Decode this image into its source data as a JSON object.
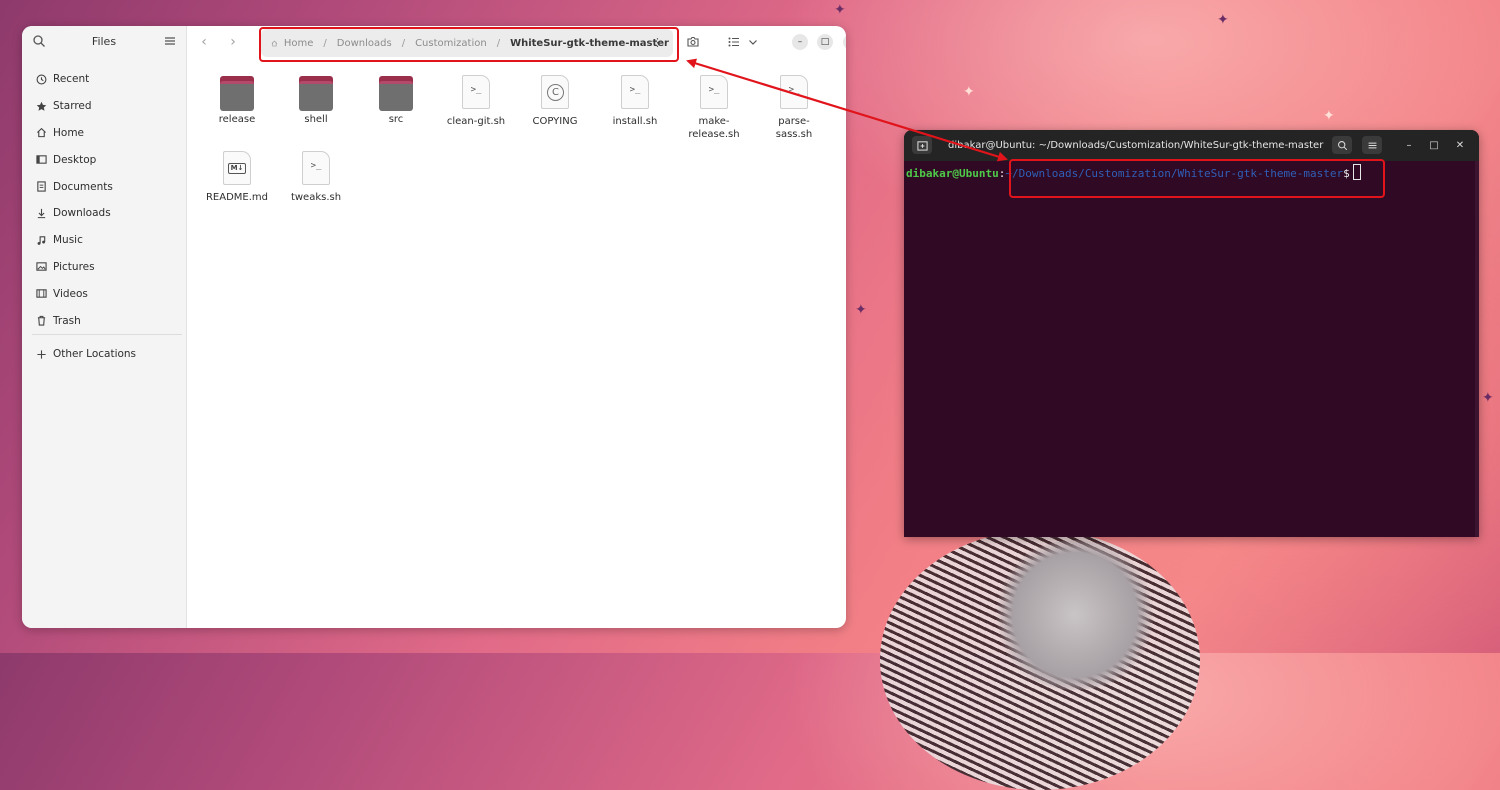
{
  "files_window": {
    "title": "Files",
    "sidebar": {
      "items": [
        {
          "label": "Recent",
          "icon": "clock-icon"
        },
        {
          "label": "Starred",
          "icon": "star-icon"
        },
        {
          "label": "Home",
          "icon": "home-icon"
        },
        {
          "label": "Desktop",
          "icon": "desktop-icon"
        },
        {
          "label": "Documents",
          "icon": "document-icon"
        },
        {
          "label": "Downloads",
          "icon": "download-icon"
        },
        {
          "label": "Music",
          "icon": "music-icon"
        },
        {
          "label": "Pictures",
          "icon": "picture-icon"
        },
        {
          "label": "Videos",
          "icon": "video-icon"
        },
        {
          "label": "Trash",
          "icon": "trash-icon"
        }
      ],
      "other": {
        "label": "Other Locations",
        "icon": "plus-icon"
      }
    },
    "pathbar": {
      "crumbs": [
        "Home",
        "Downloads",
        "Customization"
      ],
      "current": "WhiteSur-gtk-theme-master"
    },
    "files": [
      {
        "name": "release",
        "kind": "folder"
      },
      {
        "name": "shell",
        "kind": "folder"
      },
      {
        "name": "src",
        "kind": "folder"
      },
      {
        "name": "clean-git.sh",
        "kind": "script"
      },
      {
        "name": "COPYING",
        "kind": "license"
      },
      {
        "name": "install.sh",
        "kind": "script"
      },
      {
        "name": "make-release.sh",
        "line1": "make-",
        "line2": "release.sh",
        "kind": "script"
      },
      {
        "name": "parse-sass.sh",
        "line1": "parse-",
        "line2": "sass.sh",
        "kind": "script"
      },
      {
        "name": "README.md",
        "kind": "markdown"
      },
      {
        "name": "tweaks.sh",
        "kind": "script"
      }
    ]
  },
  "terminal": {
    "title": "dibakar@Ubuntu: ~/Downloads/Customization/WhiteSur-gtk-theme-master",
    "prompt_user": "dibakar@Ubuntu",
    "prompt_sep": ":",
    "prompt_path": "~/Downloads/Customization/WhiteSur-gtk-theme-master",
    "prompt_end": "$",
    "colors": {
      "user": "#4ec949",
      "path": "#2f5fb8",
      "background": "#300a24"
    }
  },
  "annotation": {
    "color": "#e0141a"
  }
}
